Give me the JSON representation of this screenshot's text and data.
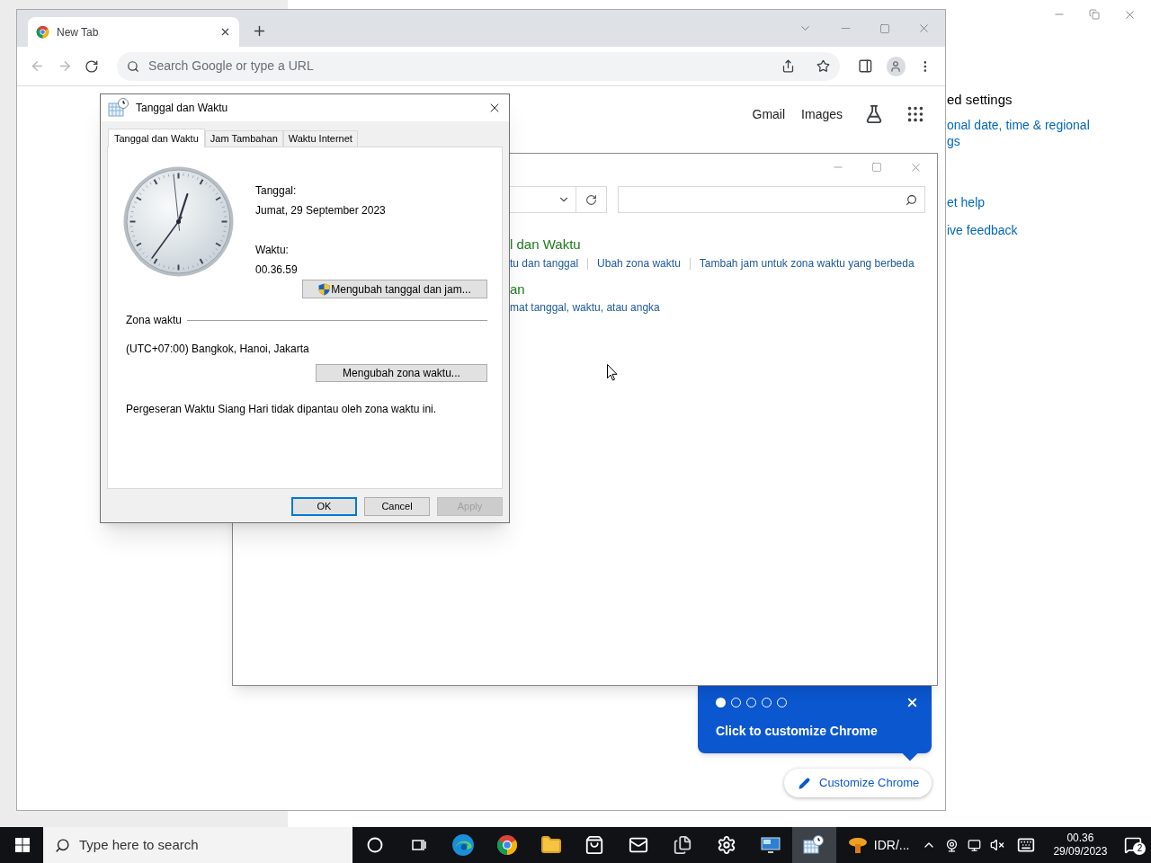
{
  "settings_window": {
    "heading": "ed settings",
    "link_lines": [
      "onal date, time & regional",
      "gs"
    ],
    "help_links": [
      "et help",
      "ive feedback"
    ]
  },
  "browser": {
    "tab": {
      "title": "New Tab"
    },
    "omnibox": {
      "placeholder": "Search Google or type a URL"
    },
    "header_links": [
      "Gmail",
      "Images"
    ],
    "promo": {
      "steps": [
        {
          "selected": true
        },
        {
          "selected": false
        },
        {
          "selected": false
        },
        {
          "selected": false
        },
        {
          "selected": false
        }
      ],
      "text": "Click to customize Chrome"
    },
    "customize_button": "Customize Chrome"
  },
  "control_panel": {
    "category_title": "l dan Waktu",
    "category_links": [
      "tu dan tanggal",
      "Ubah zona waktu",
      "Tambah jam untuk zona waktu yang berbeda"
    ],
    "category2_title": "an",
    "category2_links": [
      "mat tanggal, waktu, atau angka"
    ]
  },
  "dialog": {
    "title": "Tanggal dan Waktu",
    "tabs": [
      {
        "label": "Tanggal dan Waktu",
        "selected": true
      },
      {
        "label": "Jam Tambahan",
        "selected": false
      },
      {
        "label": "Waktu Internet",
        "selected": false
      }
    ],
    "date_label": "Tanggal:",
    "date": "Jumat, 29 September 2023",
    "time_label": "Waktu:",
    "time": "00.36.59",
    "change_datetime_button": "Mengubah tanggal dan jam...",
    "timezone_heading": "Zona waktu",
    "timezone": "(UTC+07:00) Bangkok, Hanoi, Jakarta",
    "change_timezone_button": "Mengubah zona waktu...",
    "dst_note": "Pergeseran Waktu Siang Hari tidak dipantau oleh zona waktu ini.",
    "buttons": [
      {
        "label": "OK",
        "kind": "default",
        "disabled": false
      },
      {
        "label": "Cancel",
        "kind": "normal",
        "disabled": false
      },
      {
        "label": "Apply",
        "kind": "normal",
        "disabled": true
      }
    ]
  },
  "taskbar": {
    "search_placeholder": "Type here to search",
    "apps": [
      {
        "kind": "cortana",
        "selected": false
      },
      {
        "kind": "taskview",
        "selected": false
      },
      {
        "kind": "edge",
        "selected": false
      },
      {
        "kind": "chrome",
        "selected": false
      },
      {
        "kind": "explorer",
        "selected": false
      },
      {
        "kind": "store",
        "selected": false
      },
      {
        "kind": "mail",
        "selected": false
      },
      {
        "kind": "documents",
        "selected": false
      },
      {
        "kind": "settings",
        "selected": false
      },
      {
        "kind": "monitor",
        "selected": false
      },
      {
        "kind": "datetime",
        "selected": true
      }
    ],
    "tray_label": "IDR/...",
    "time": "00.36",
    "date": "29/09/2023",
    "notifications": "2"
  }
}
